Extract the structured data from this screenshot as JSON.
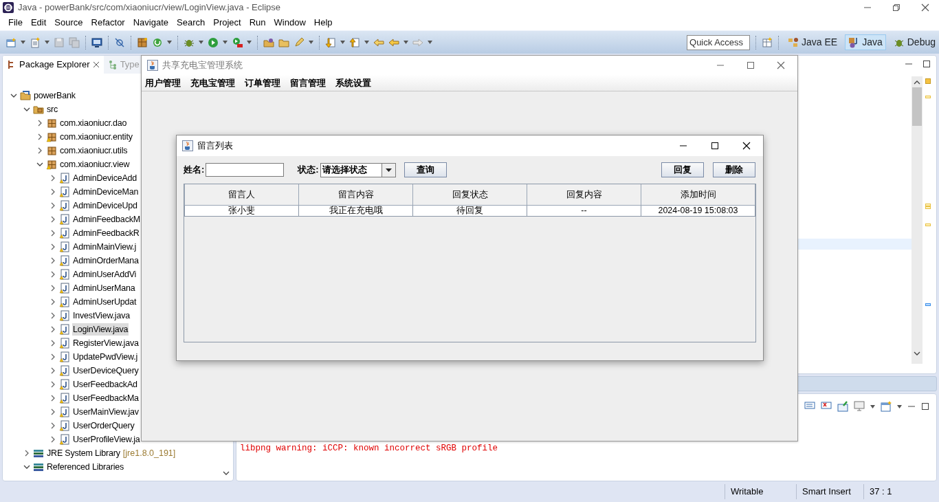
{
  "window": {
    "title": "Java - powerBank/src/com/xiaoniucr/view/LoginView.java - Eclipse"
  },
  "menu": [
    "File",
    "Edit",
    "Source",
    "Refactor",
    "Navigate",
    "Search",
    "Project",
    "Run",
    "Window",
    "Help"
  ],
  "toolbar": {
    "quick_access": {
      "placeholder": "Quick Access"
    },
    "perspectives": [
      {
        "label": "Java EE",
        "selected": false
      },
      {
        "label": "Java",
        "selected": true
      },
      {
        "label": "Debug",
        "selected": false
      }
    ]
  },
  "package_explorer": {
    "tabs": [
      {
        "label": "Package Explorer",
        "selected": true
      },
      {
        "label": "Type",
        "selected": false
      }
    ],
    "tree": [
      {
        "label": "powerBank",
        "kind": "project",
        "expanded": true,
        "selected": false,
        "children": [
          {
            "label": "src",
            "kind": "folder",
            "expanded": true,
            "selected": false,
            "children": [
              {
                "label": "com.xiaoniucr.dao",
                "kind": "package",
                "warning": false,
                "expanded": false,
                "selected": false
              },
              {
                "label": "com.xiaoniucr.entity",
                "kind": "package",
                "warning": true,
                "expanded": false,
                "selected": false
              },
              {
                "label": "com.xiaoniucr.utils",
                "kind": "package",
                "warning": false,
                "expanded": false,
                "selected": false
              },
              {
                "label": "com.xiaoniucr.view",
                "kind": "package",
                "warning": true,
                "expanded": true,
                "selected": false,
                "children": [
                  {
                    "label": "AdminDeviceAdd",
                    "kind": "java",
                    "expanded": false,
                    "selected": false
                  },
                  {
                    "label": "AdminDeviceMan",
                    "kind": "java",
                    "expanded": false,
                    "selected": false
                  },
                  {
                    "label": "AdminDeviceUpd",
                    "kind": "java",
                    "expanded": false,
                    "selected": false
                  },
                  {
                    "label": "AdminFeedbackM",
                    "kind": "java",
                    "expanded": false,
                    "selected": false
                  },
                  {
                    "label": "AdminFeedbackR",
                    "kind": "java",
                    "expanded": false,
                    "selected": false
                  },
                  {
                    "label": "AdminMainView.j",
                    "kind": "java",
                    "expanded": false,
                    "selected": false
                  },
                  {
                    "label": "AdminOrderMana",
                    "kind": "java",
                    "expanded": false,
                    "selected": false
                  },
                  {
                    "label": "AdminUserAddVi",
                    "kind": "java",
                    "expanded": false,
                    "selected": false
                  },
                  {
                    "label": "AdminUserMana",
                    "kind": "java",
                    "expanded": false,
                    "selected": false
                  },
                  {
                    "label": "AdminUserUpdat",
                    "kind": "java",
                    "expanded": false,
                    "selected": false
                  },
                  {
                    "label": "InvestView.java",
                    "kind": "java",
                    "expanded": false,
                    "selected": false
                  },
                  {
                    "label": "LoginView.java",
                    "kind": "java",
                    "expanded": false,
                    "selected": true
                  },
                  {
                    "label": "RegisterView.java",
                    "kind": "java",
                    "expanded": false,
                    "selected": false
                  },
                  {
                    "label": "UpdatePwdView.j",
                    "kind": "java",
                    "expanded": false,
                    "selected": false
                  },
                  {
                    "label": "UserDeviceQuery",
                    "kind": "java",
                    "expanded": false,
                    "selected": false
                  },
                  {
                    "label": "UserFeedbackAd",
                    "kind": "java",
                    "expanded": false,
                    "selected": false
                  },
                  {
                    "label": "UserFeedbackMa",
                    "kind": "java",
                    "expanded": false,
                    "selected": false
                  },
                  {
                    "label": "UserMainView.jav",
                    "kind": "java",
                    "expanded": false,
                    "selected": false
                  },
                  {
                    "label": "UserOrderQuery",
                    "kind": "java",
                    "expanded": false,
                    "selected": false
                  },
                  {
                    "label": "UserProfileView.ja",
                    "kind": "java",
                    "expanded": false,
                    "selected": false
                  }
                ]
              }
            ]
          },
          {
            "label": "JRE System Library",
            "suffix": "[jre1.8.0_191]",
            "kind": "library",
            "expanded": false,
            "selected": false
          },
          {
            "label": "Referenced Libraries",
            "kind": "library",
            "expanded": true,
            "selected": false
          }
        ]
      }
    ]
  },
  "console": {
    "lines": [
      "libpng warning: iCCP: known incorrect sRGB profile"
    ]
  },
  "status_bar": [
    "Writable",
    "Smart Insert",
    "37 : 1"
  ],
  "app_window": {
    "title": "共享充电宝管理系统",
    "menu": [
      "用户管理",
      "充电宝管理",
      "订单管理",
      "留言管理",
      "系统设置"
    ]
  },
  "dialog": {
    "title": "留言列表",
    "name_label": "姓名:",
    "status_label": "状态:",
    "status_value": "请选择状态",
    "query_button": "查询",
    "reply_button": "回复",
    "delete_button": "删除",
    "table": {
      "columns": [
        "留言人",
        "留言内容",
        "回复状态",
        "回复内容",
        "添加时间"
      ],
      "rows": [
        [
          "张小斐",
          "我正在充电哦",
          "待回复",
          "--",
          "2024-08-19 15:08:03"
        ]
      ]
    }
  }
}
